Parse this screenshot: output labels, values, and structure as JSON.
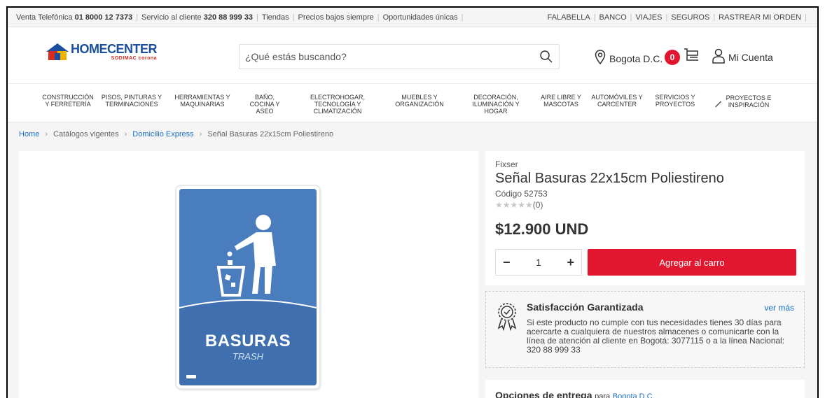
{
  "topbar": {
    "left": [
      {
        "text": "Venta Telefónica ",
        "bold": "01 8000 12 7373"
      },
      {
        "text": "Servicio al cliente ",
        "bold": "320 88 999 33"
      },
      {
        "text": "Tiendas"
      },
      {
        "text": "Precios bajos siempre"
      },
      {
        "text": "Oportunidades únicas"
      }
    ],
    "right": [
      "FALABELLA",
      "BANCO",
      "VIAJES",
      "SEGUROS",
      "RASTREAR MI ORDEN"
    ]
  },
  "header": {
    "logo_brand": "HOMECENTER",
    "logo_sub": "SODIMAC corona",
    "search_placeholder": "¿Qué estás buscando?",
    "location": "Bogota D.C.",
    "cart_count": "0",
    "account_label": "Mi Cuenta"
  },
  "nav": [
    "CONSTRUCCIÓN\nY FERRETERÍA",
    "PISOS, PINTURAS Y\nTERMINACIONES",
    "HERRAMIENTAS Y\nMAQUINARIAS",
    "BAÑO,\nCOCINA Y\nASEO",
    "ELECTROHOGAR,\nTECNOLOGÍA Y\nCLIMATIZACIÓN",
    "MUEBLES Y\nORGANIZACIÓN",
    "DECORACIÓN,\nILUMINACIÓN Y\nHOGAR",
    "AIRE LIBRE Y\nMASCOTAS",
    "AUTOMÓVILES Y\nCARCENTER",
    "SERVICIOS Y\nPROYECTOS",
    "PROYECTOS E\nINSPIRACIÓN"
  ],
  "breadcrumb": [
    "Home",
    "Catálogos vigentes",
    "Domicilio Express",
    "Señal Basuras 22x15cm Poliestireno"
  ],
  "product": {
    "brand": "Fixser",
    "title": "Señal Basuras 22x15cm Poliestireno",
    "code": "Código 52753",
    "rating_count": "(0)",
    "rating_stars": 0,
    "price": "$12.900 UND",
    "quantity": "1",
    "add_to_cart": "Agregar al carro",
    "sign_label": "BASURAS",
    "sign_sublabel": "TRASH"
  },
  "guarantee": {
    "title": "Satisfacción Garantizada",
    "more": "ver más",
    "text": "Si este producto no cumple con tus necesidades tienes 30 días para acercarte a cualquiera de nuestros almacenes o comunicarte con la línea de atención al cliente en Bogotá: 3077115 o a la línea Nacional: 320 88 999 33"
  },
  "delivery": {
    "title": "Opciones de entrega",
    "for": "para",
    "city": "Bogota D.C."
  }
}
